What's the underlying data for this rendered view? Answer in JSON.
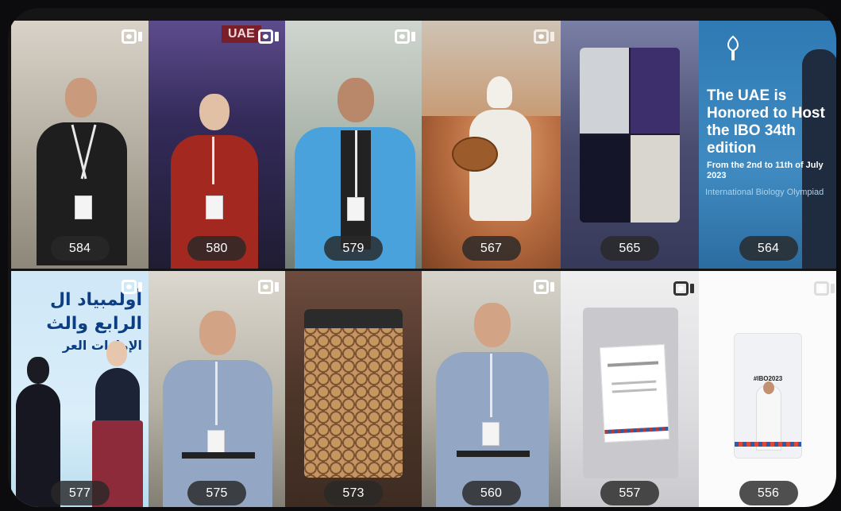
{
  "grid": {
    "tiles": [
      {
        "views": "584"
      },
      {
        "views": "580"
      },
      {
        "views": "579"
      },
      {
        "views": "567"
      },
      {
        "views": "565"
      },
      {
        "views": "564"
      },
      {
        "views": "577"
      },
      {
        "views": "575"
      },
      {
        "views": "573"
      },
      {
        "views": "560"
      },
      {
        "views": "557"
      },
      {
        "views": "556"
      }
    ]
  },
  "promo": {
    "headline": "The UAE is Honored to Host the IBO 34th edition",
    "dates": "From the 2nd to 11th of July 2023",
    "footer": "International Biology Olympiad"
  },
  "arabic_banner": {
    "line1": "أولمبياد ال",
    "line2": "الرابع والث",
    "line3": "الإمارات العر"
  },
  "stage_sign": "UAE",
  "hashtag": "#IBO2023",
  "icons": [
    "reel-icon"
  ],
  "colors": {
    "pill_bg": "#282828",
    "promo_blue": "#2f7ab4",
    "arabic_blue": "#0d3d82"
  }
}
